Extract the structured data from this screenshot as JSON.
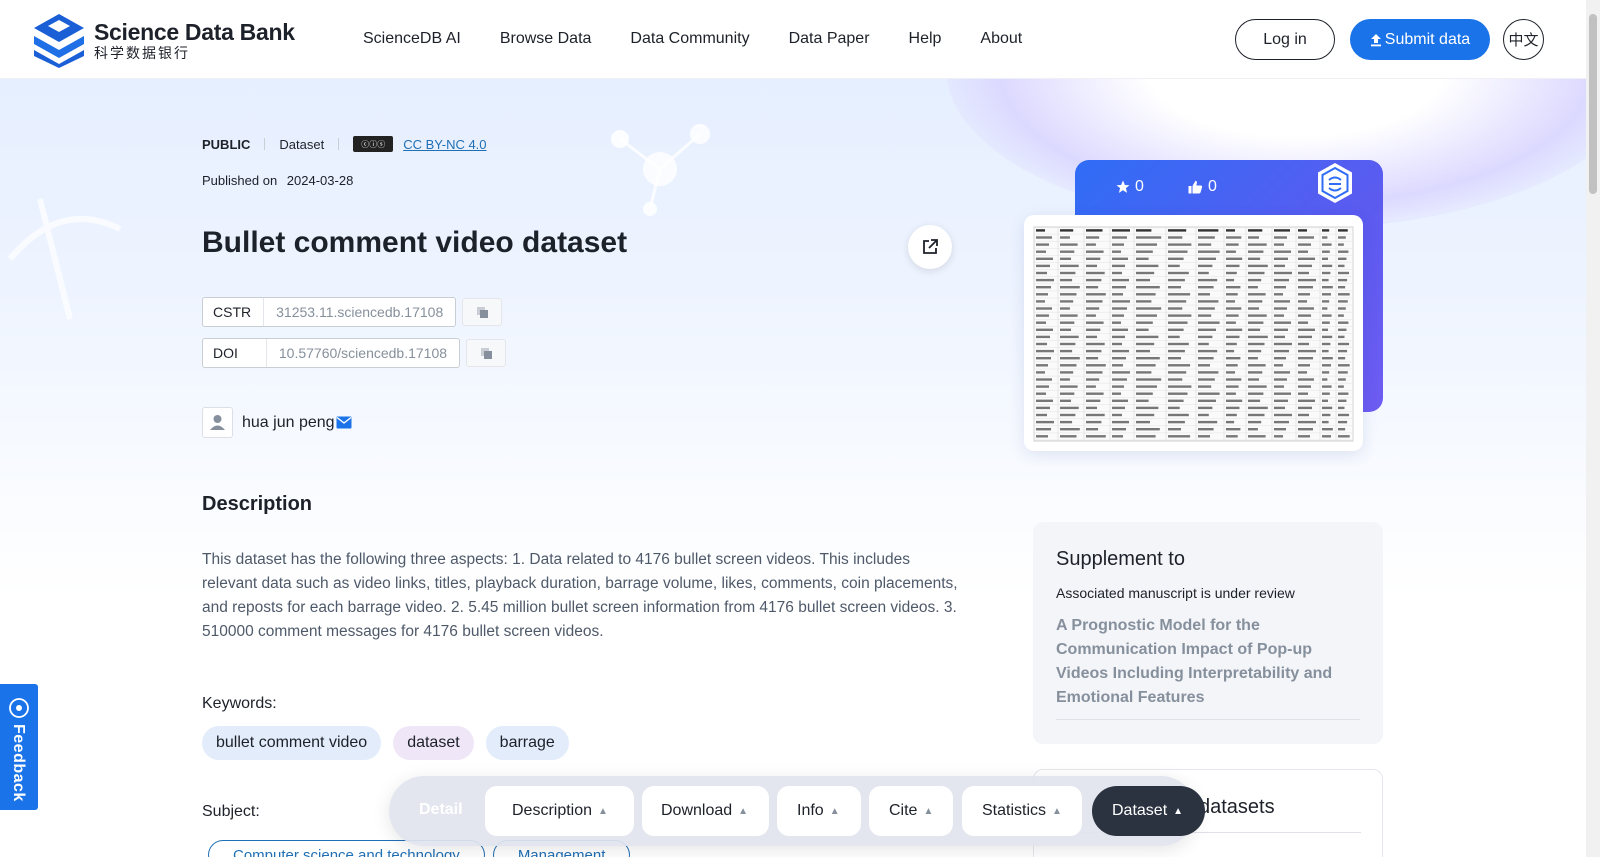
{
  "header": {
    "logo_en": "Science Data Bank",
    "logo_cn": "科学数据银行",
    "nav": [
      "ScienceDB AI",
      "Browse Data",
      "Data Community",
      "Data Paper",
      "Help",
      "About"
    ],
    "login_label": "Log in",
    "submit_label": "Submit data",
    "lang_label": "中文"
  },
  "dataset": {
    "access": "PUBLIC",
    "type": "Dataset",
    "license": "CC BY-NC 4.0",
    "published_label": "Published on",
    "published_date": "2024-03-28",
    "title": "Bullet comment video dataset",
    "cstr_label": "CSTR",
    "cstr_value": "31253.11.sciencedb.17108",
    "doi_label": "DOI",
    "doi_value": "10.57760/sciencedb.17108",
    "author": "hua jun peng",
    "description_title": "Description",
    "description": "This dataset has the following three aspects: 1. Data related to 4176 bullet screen videos. This includes relevant data such as video links, titles, playback duration, barrage volume, likes, comments, coin placements, and reposts for each barrage video. 2. 5.45 million bullet screen information from 4176 bullet screen videos. 3. 510000 comment messages for 4176 bullet screen videos.",
    "keywords_label": "Keywords:",
    "keywords": [
      {
        "text": "bullet comment video",
        "color": "#e3ecfb"
      },
      {
        "text": "dataset",
        "color": "#efe6f8"
      },
      {
        "text": "barrage",
        "color": "#e3ecfb"
      }
    ],
    "subject_label": "Subject:",
    "subjects": [
      "Computer science and technology",
      "Management"
    ]
  },
  "card": {
    "stars": "0",
    "likes": "0"
  },
  "supplement": {
    "title": "Supplement to",
    "status": "Associated manuscript is under review",
    "paper": "A Prognostic Model for the Communication Impact of Pop-up Videos Including Interpretability and Emotional Features"
  },
  "related": {
    "title": "datasets"
  },
  "tabbar": {
    "detail": "Detail",
    "tabs": [
      "Description",
      "Download",
      "Info",
      "Cite",
      "Statistics",
      "Dataset"
    ],
    "active": "Dataset"
  },
  "feedback": {
    "label": "Feedback"
  },
  "colors": {
    "primary": "#1a73e8",
    "link": "#1f6fb5",
    "card_gradient_start": "#2f6df6",
    "card_gradient_end": "#6e5cf2",
    "active_tab": "#2b3340"
  }
}
